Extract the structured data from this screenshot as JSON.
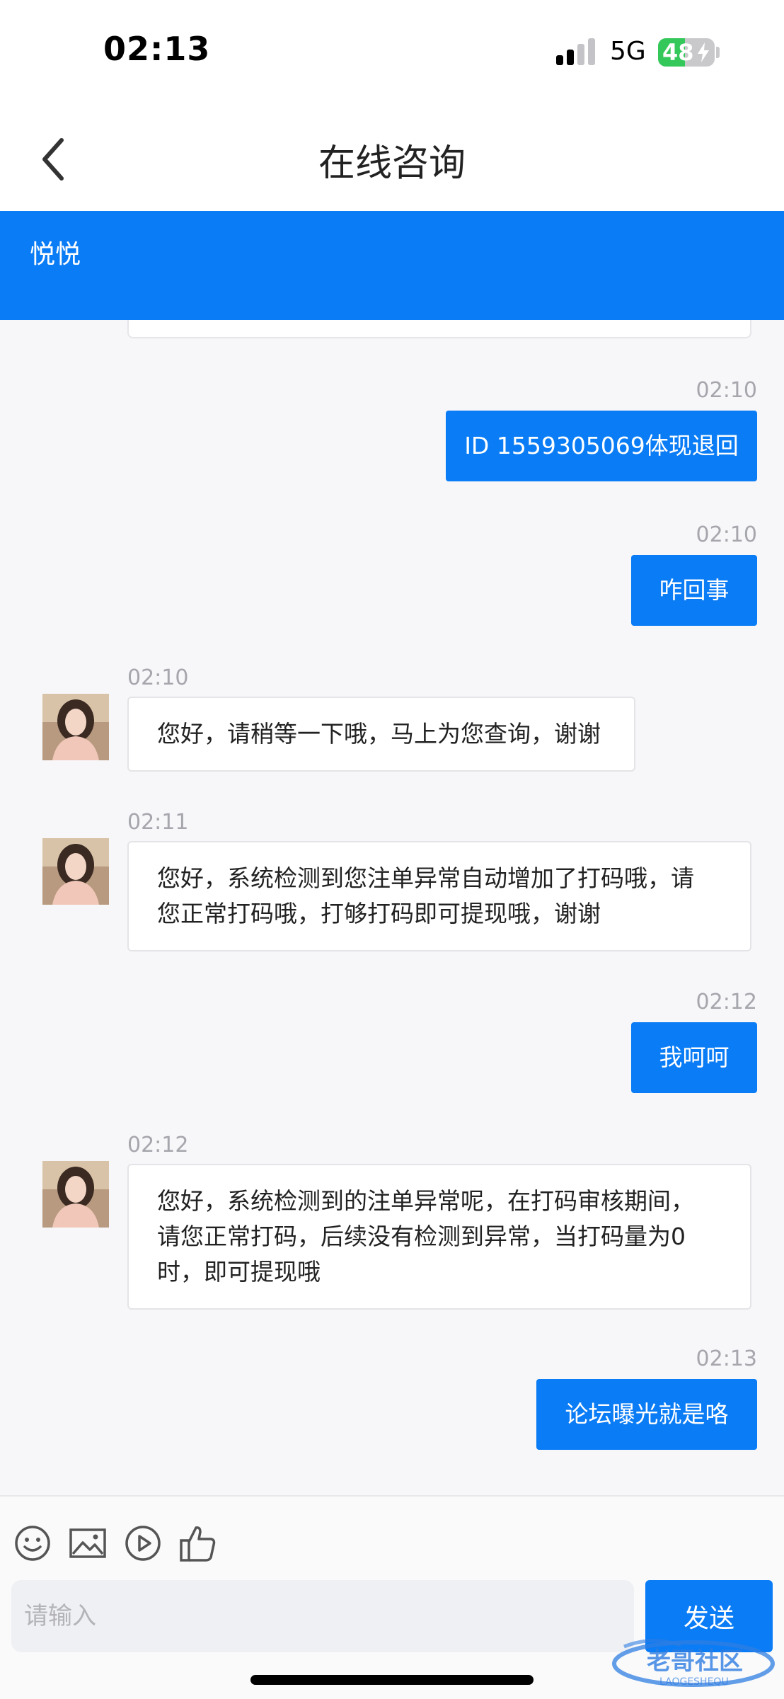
{
  "status_bar": {
    "time": "02:13",
    "network": "5G",
    "battery": "48",
    "battery_level": 0.48,
    "signal_bars_active": 2,
    "signal_bars_total": 4
  },
  "nav": {
    "back_icon": "chevron-left-icon",
    "title": "在线咨询"
  },
  "agent": {
    "name": "悦悦"
  },
  "messages": [
    {
      "direction": "outgoing",
      "time": "02:10",
      "text": "ID 1559305069体现退回"
    },
    {
      "direction": "outgoing",
      "time": "02:10",
      "text": "咋回事"
    },
    {
      "direction": "incoming",
      "time": "02:10",
      "lines": [
        "您好，请稍等一下哦，马上为您查询，谢谢"
      ]
    },
    {
      "direction": "incoming",
      "time": "02:11",
      "lines": [
        "您好，系统检测到您注单异常自动增加了打码哦，请",
        "您正常打码哦，打够打码即可提现哦，谢谢"
      ]
    },
    {
      "direction": "outgoing",
      "time": "02:12",
      "text": "我呵呵"
    },
    {
      "direction": "incoming",
      "time": "02:12",
      "lines": [
        "您好，系统检测到的注单异常呢，在打码审核期间，",
        "请您正常打码，后续没有检测到异常，当打码量为0",
        "时，即可提现哦"
      ]
    },
    {
      "direction": "outgoing",
      "time": "02:13",
      "text": "论坛曝光就是咯"
    }
  ],
  "input": {
    "placeholder": "请输入",
    "send_label": "发送",
    "tool_icons": [
      "emoji-icon",
      "image-icon",
      "video-icon",
      "thumbs-up-icon"
    ]
  },
  "colors": {
    "accent": "#0a7cf5",
    "battery_green": "#34c759",
    "timestamp_gray": "#a6a6ad"
  }
}
